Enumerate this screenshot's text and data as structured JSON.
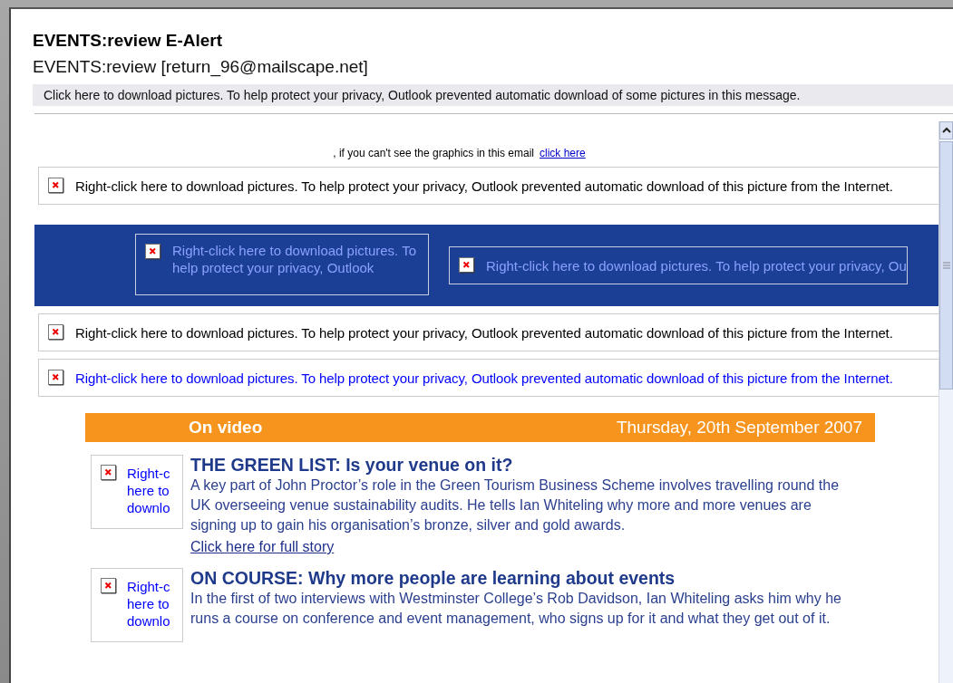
{
  "message": {
    "subject": "EVENTS:review E-Alert",
    "from": "EVENTS:review [return_96@mailscape.net]",
    "info_bar": "Click here to download pictures. To help protect your privacy, Outlook prevented automatic download of some pictures in this message."
  },
  "body": {
    "graphics_note": ", if you can't see the graphics in this email",
    "graphics_link": "click here",
    "blocked_rows": [
      {
        "kind": "row",
        "text": "Right-click here to download pictures. To help protect your privacy, Outlook prevented automatic download of this picture from the Internet.",
        "color": "#000000"
      },
      {
        "kind": "banner",
        "images": [
          {
            "lines": [
              "Right-click here to download pictures. To",
              "help protect your privacy, Outlook"
            ]
          },
          {
            "lines": [
              "Right-click here to download pictures. To help protect your privacy, Ou"
            ]
          }
        ]
      },
      {
        "kind": "row",
        "text": "Right-click here to download pictures. To help protect your privacy, Outlook prevented automatic download of this picture from the Internet.",
        "color": "#000000"
      },
      {
        "kind": "row",
        "text": "Right-click here to download pictures. To help protect your privacy, Outlook prevented automatic download of this picture from the Internet.",
        "color": "#0000ff"
      }
    ],
    "section": {
      "title": "On video",
      "date": "Thursday, 20th September 2007"
    },
    "stories": [
      {
        "thumb_lines": [
          "Right-c",
          "here to",
          "downlo"
        ],
        "headline": "THE GREEN LIST: Is your venue on it?",
        "summary": "A key part of John Proctor’s role in the Green Tourism Business Scheme involves travelling round the UK overseeing venue sustainability audits. He tells Ian Whiteling why more and more venues are signing up to gain his organisation’s bronze, silver and gold awards.",
        "link": "Click here for full story"
      },
      {
        "thumb_lines": [
          "Right-c",
          "here to",
          "downlo"
        ],
        "headline": "ON COURSE: Why more people are learning about events",
        "summary": "In the first of two interviews with Westminster College’s Rob Davidson, Ian Whiteling asks him why he runs a course on conference and event management, who signs up for it and what they get out of it."
      }
    ]
  }
}
